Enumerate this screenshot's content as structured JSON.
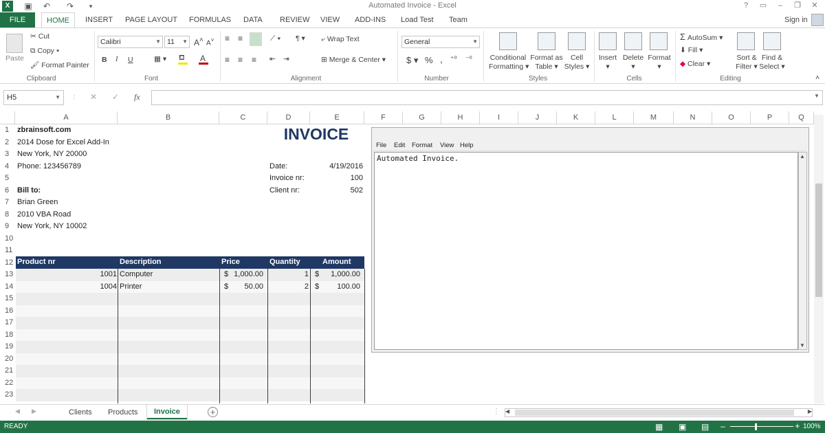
{
  "window": {
    "title": "Automated Invoice - Excel",
    "help": "?",
    "sign_in": "Sign in"
  },
  "ribbon_tabs": [
    "FILE",
    "HOME",
    "INSERT",
    "PAGE LAYOUT",
    "FORMULAS",
    "DATA",
    "REVIEW",
    "VIEW",
    "ADD-INS",
    "Load Test",
    "Team"
  ],
  "clipboard": {
    "paste": "Paste",
    "cut": "Cut",
    "copy": "Copy",
    "format_painter": "Format Painter",
    "label": "Clipboard"
  },
  "font": {
    "name": "Calibri",
    "size": "11",
    "label": "Font",
    "bold": "B",
    "italic": "I",
    "underline": "U"
  },
  "alignment": {
    "wrap": "Wrap Text",
    "merge": "Merge & Center",
    "label": "Alignment"
  },
  "number": {
    "format": "General",
    "currency": "$",
    "percent": "%",
    "comma": ",",
    "label": "Number"
  },
  "styles": {
    "conditional": "Conditional",
    "conditional2": "Formatting",
    "format_table": "Format as",
    "format_table2": "Table",
    "cell_styles": "Cell",
    "cell_styles2": "Styles",
    "label": "Styles"
  },
  "cells": {
    "insert": "Insert",
    "delete": "Delete",
    "format": "Format",
    "label": "Cells"
  },
  "editing": {
    "autosum": "AutoSum",
    "fill": "Fill",
    "clear": "Clear",
    "sort": "Sort &",
    "sort2": "Filter",
    "find": "Find &",
    "find2": "Select",
    "label": "Editing"
  },
  "formula_bar": {
    "name_box": "H5",
    "fx": "fx",
    "cancel": "✕",
    "enter": "✓",
    "formula": ""
  },
  "columns": [
    "A",
    "B",
    "C",
    "D",
    "E",
    "F",
    "G",
    "H",
    "I",
    "J",
    "K",
    "L",
    "M",
    "N",
    "O",
    "P",
    "Q"
  ],
  "rows": [
    "1",
    "2",
    "3",
    "4",
    "5",
    "6",
    "7",
    "8",
    "9",
    "10",
    "11",
    "12",
    "13",
    "14",
    "15",
    "16",
    "17",
    "18",
    "19",
    "20",
    "21",
    "22",
    "23"
  ],
  "sheet": {
    "company": "zbrainsoft.com",
    "addr1": "2014 Dose for Excel Add-In",
    "addr2": "New York, NY 20000",
    "phone": "Phone: 123456789",
    "invoice_title": "INVOICE",
    "date_label": "Date:",
    "date_value": "4/19/2016",
    "invoice_nr_label": "Invoice nr:",
    "invoice_nr_value": "100",
    "client_nr_label": "Client nr:",
    "client_nr_value": "502",
    "bill_to": "Bill to:",
    "bill_name": "Brian Green",
    "bill_addr1": "2010 VBA Road",
    "bill_addr2": "New York, NY 10002",
    "table_headers": [
      "Product nr",
      "Description",
      "Price",
      "Quantity",
      "Amount"
    ],
    "items": [
      {
        "product": "1001",
        "description": "Computer",
        "price_cur": "$",
        "price": "1,000.00",
        "qty": "1",
        "amt_cur": "$",
        "amount": "1,000.00"
      },
      {
        "product": "1004",
        "description": "Printer",
        "price_cur": "$",
        "price": "50.00",
        "qty": "2",
        "amt_cur": "$",
        "amount": "100.00"
      }
    ]
  },
  "notepad": {
    "menu": [
      "File",
      "Edit",
      "Format",
      "View",
      "Help"
    ],
    "text": "Automated Invoice."
  },
  "sheet_tabs": [
    "Clients",
    "Products",
    "Invoice"
  ],
  "status": {
    "ready": "READY",
    "zoom": "100%"
  }
}
